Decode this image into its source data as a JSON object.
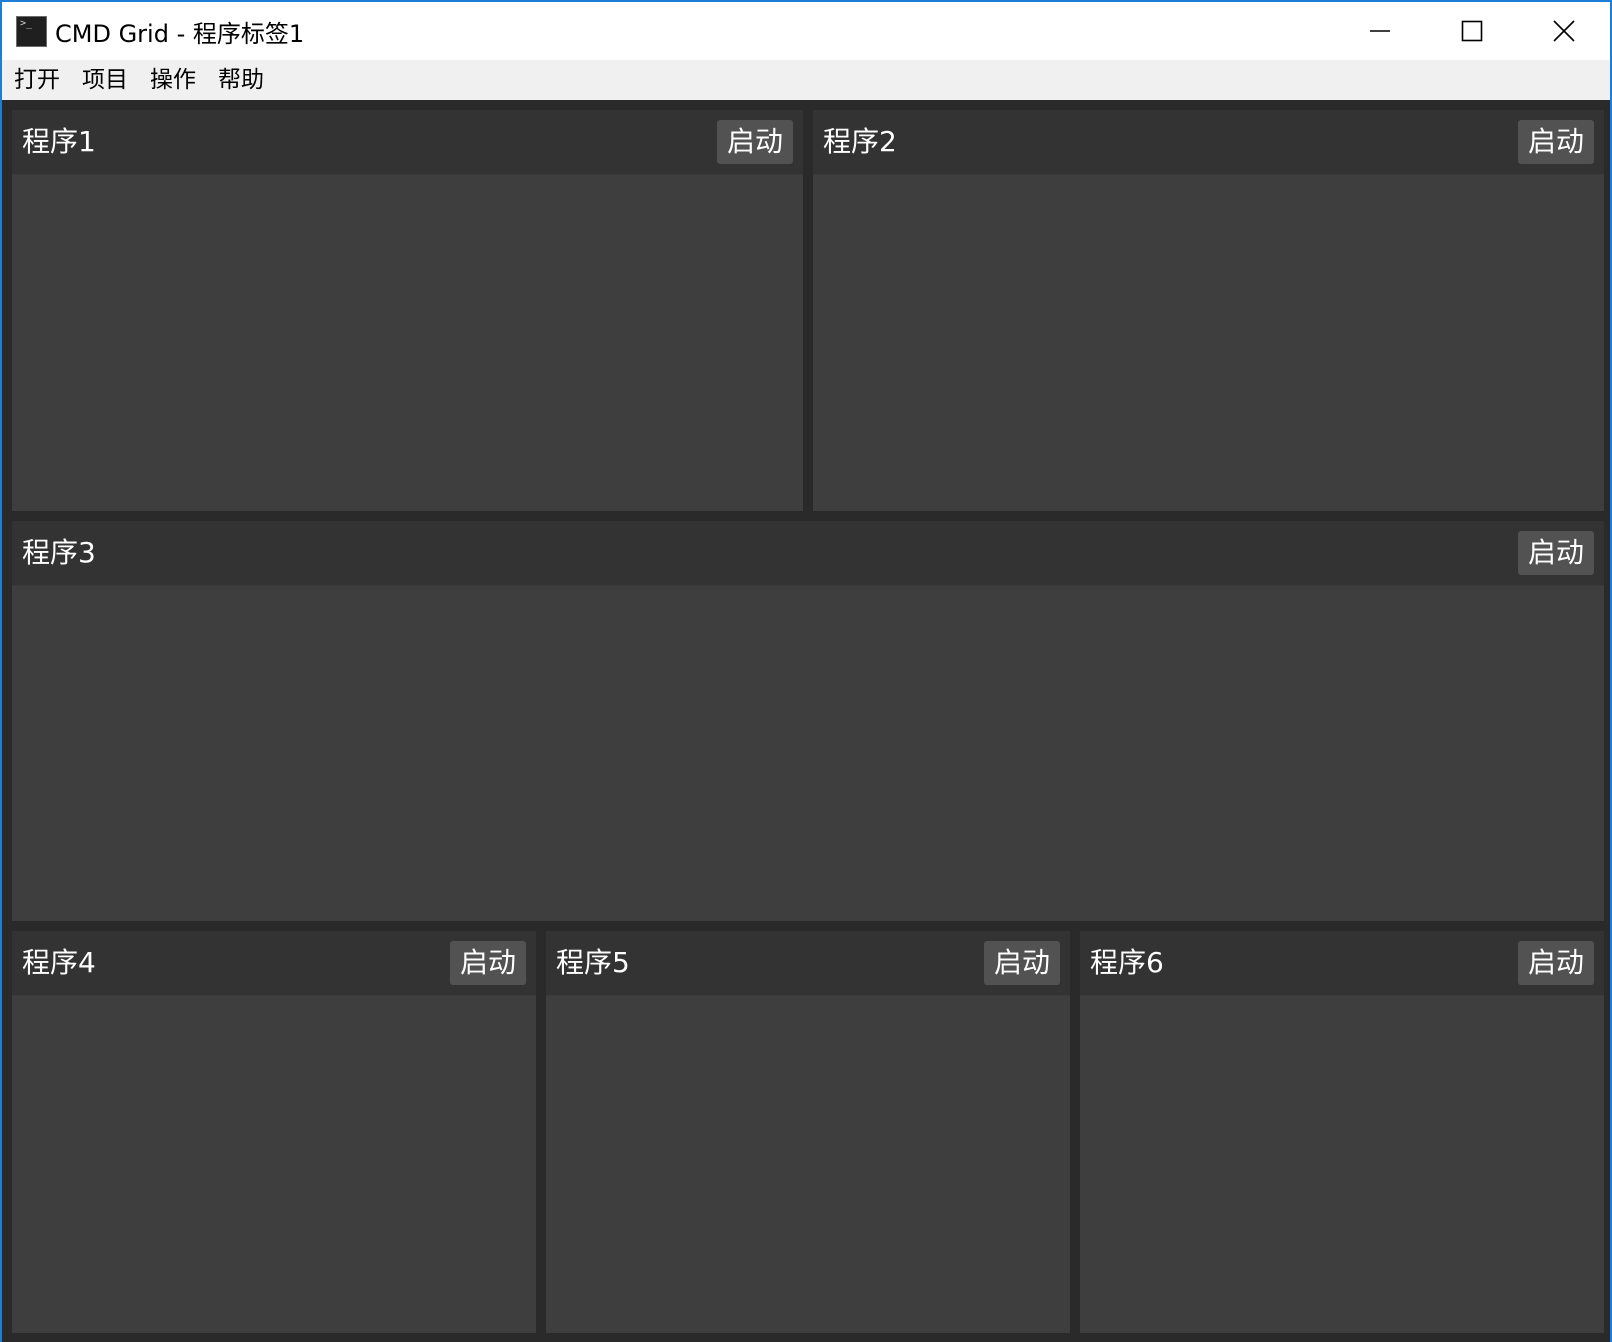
{
  "window": {
    "title": "CMD Grid - 程序标签1",
    "app_icon_glyph": ">_"
  },
  "menu": {
    "items": [
      "打开",
      "项目",
      "操作",
      "帮助"
    ]
  },
  "panels": [
    {
      "title": "程序1",
      "button": "启动"
    },
    {
      "title": "程序2",
      "button": "启动"
    },
    {
      "title": "程序3",
      "button": "启动"
    },
    {
      "title": "程序4",
      "button": "启动"
    },
    {
      "title": "程序5",
      "button": "启动"
    },
    {
      "title": "程序6",
      "button": "启动"
    }
  ],
  "colors": {
    "accent_border": "#1c7ed6",
    "client_bg": "#2a2a2a",
    "panel_header_bg": "#333333",
    "panel_body_bg": "#3e3e3e",
    "button_bg": "#525252"
  },
  "icons": {
    "minimize": "minimize-icon",
    "maximize": "maximize-icon",
    "close": "close-icon"
  }
}
